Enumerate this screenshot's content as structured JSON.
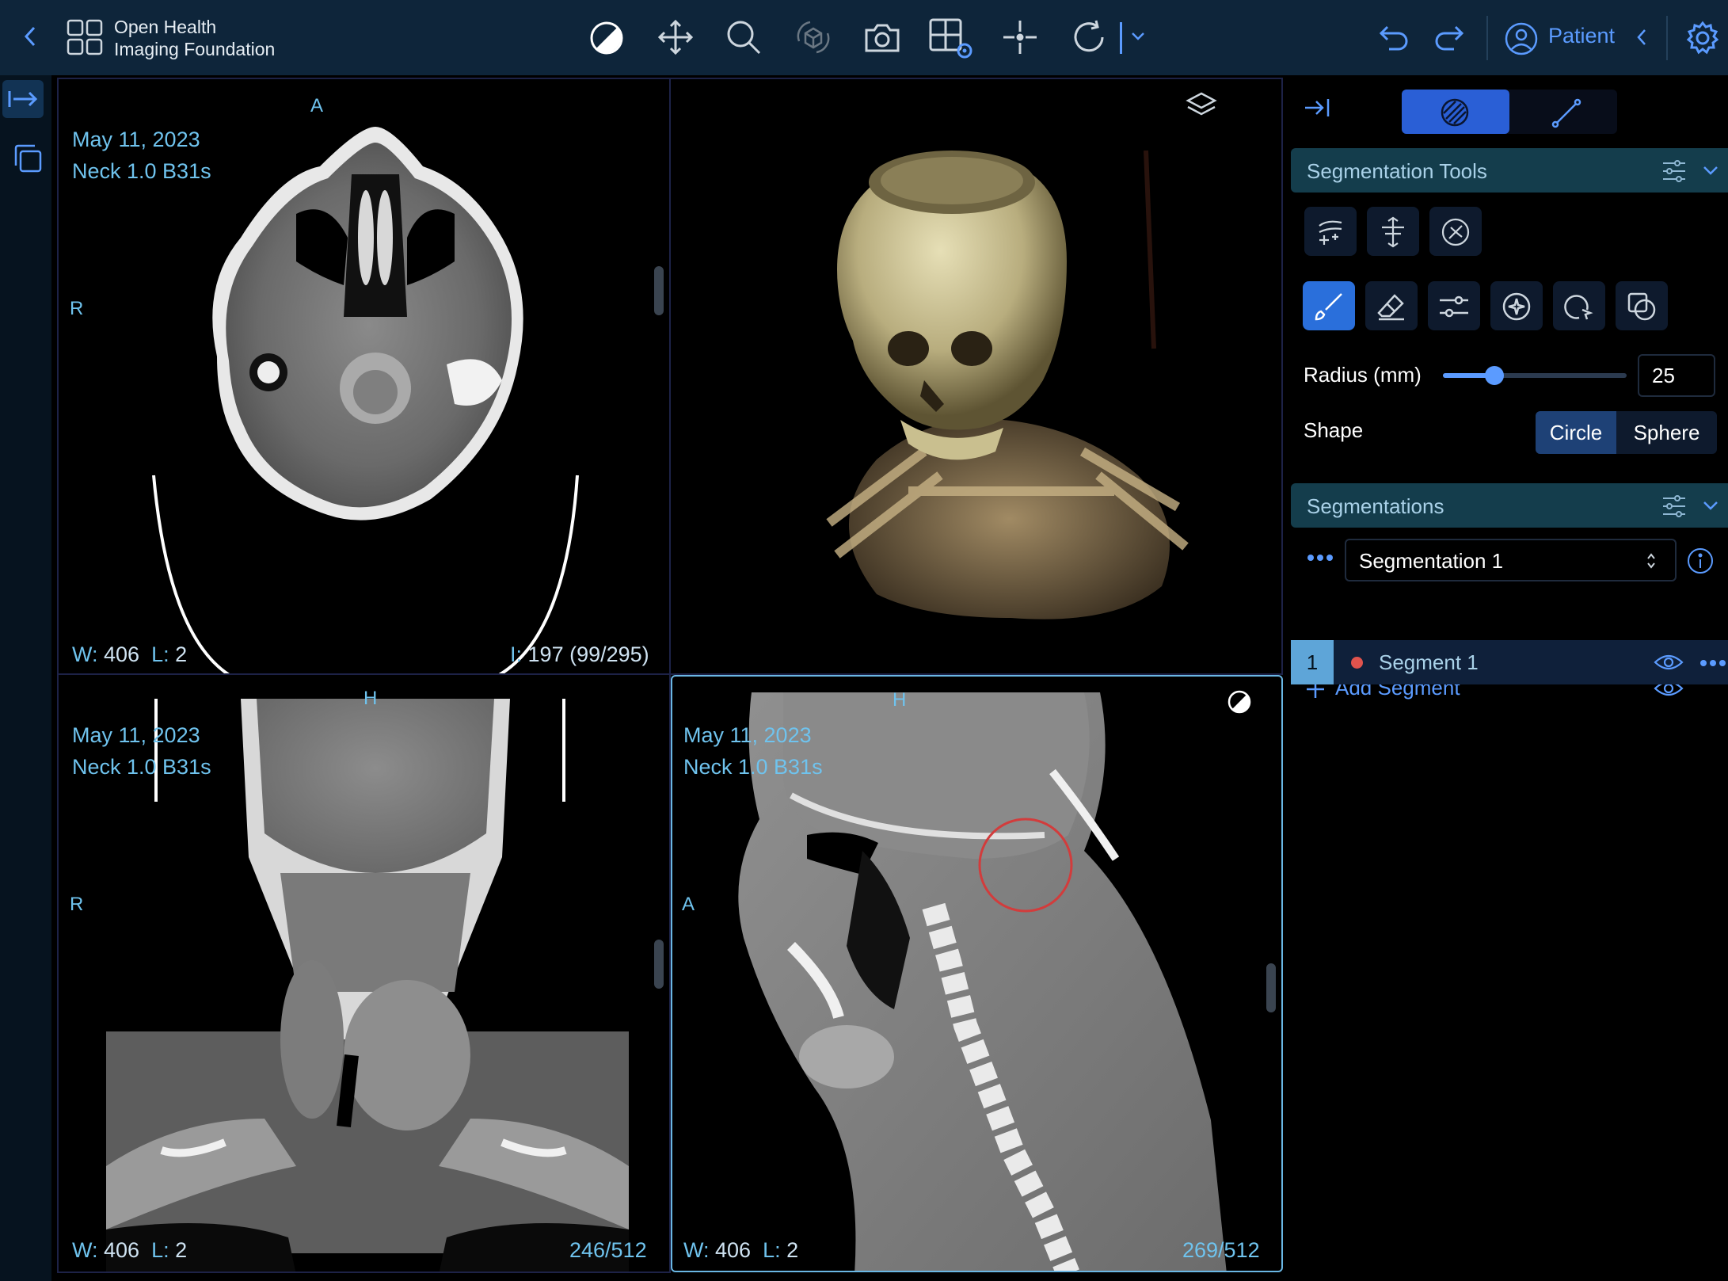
{
  "app": {
    "logo_line1": "Open Health",
    "logo_line2": "Imaging Foundation",
    "patient_label": "Patient"
  },
  "toolbar": {
    "icons": [
      "back-chevron-icon",
      "layout-grid-icon",
      "window-level-icon",
      "pan-move-icon",
      "zoom-icon",
      "rotate-3d-icon",
      "capture-camera-icon",
      "layout-settings-icon",
      "crosshairs-icon",
      "reset-view-icon",
      "more-tools-chevron-icon",
      "undo-icon",
      "redo-icon",
      "patient-avatar-icon",
      "patient-chevron-icon",
      "settings-gear-icon"
    ]
  },
  "viewports": {
    "axial": {
      "date": "May 11, 2023",
      "series": "Neck 1.0 B31s",
      "orient_top": "A",
      "orient_left": "R",
      "w_label": "W:",
      "w_value": "406",
      "l_label": "L:",
      "l_value": "2",
      "index_label": "I:",
      "index_value": "197 (99/295)"
    },
    "volume3d": {},
    "coronal": {
      "date": "May 11, 2023",
      "series": "Neck 1.0 B31s",
      "orient_top": "H",
      "orient_left": "R",
      "w_label": "W:",
      "w_value": "406",
      "l_label": "L:",
      "l_value": "2",
      "slice": "246/512"
    },
    "sagittal": {
      "date": "May 11, 2023",
      "series": "Neck 1.0 B31s",
      "orient_top": "H",
      "orient_left": "A",
      "w_label": "W:",
      "w_value": "406",
      "l_label": "L:",
      "l_value": "2",
      "slice": "269/512"
    }
  },
  "panel": {
    "seg_tools_title": "Segmentation Tools",
    "radius_label": "Radius (mm)",
    "radius_value": "25",
    "radius_fraction": 0.28,
    "shape_label": "Shape",
    "shape_options": [
      "Circle",
      "Sphere"
    ],
    "shape_selected": "Circle",
    "segmentations_title": "Segmentations",
    "segmentation_name": "Segmentation 1",
    "add_segment": "Add Segment",
    "segments": [
      {
        "index": "1",
        "name": "Segment 1",
        "color": "#e0534d"
      }
    ]
  },
  "colors": {
    "accent": "#5b9bff",
    "header_bg": "#0e253a",
    "overlay_text": "#6fc3ee",
    "section_bg": "#143d4c"
  }
}
